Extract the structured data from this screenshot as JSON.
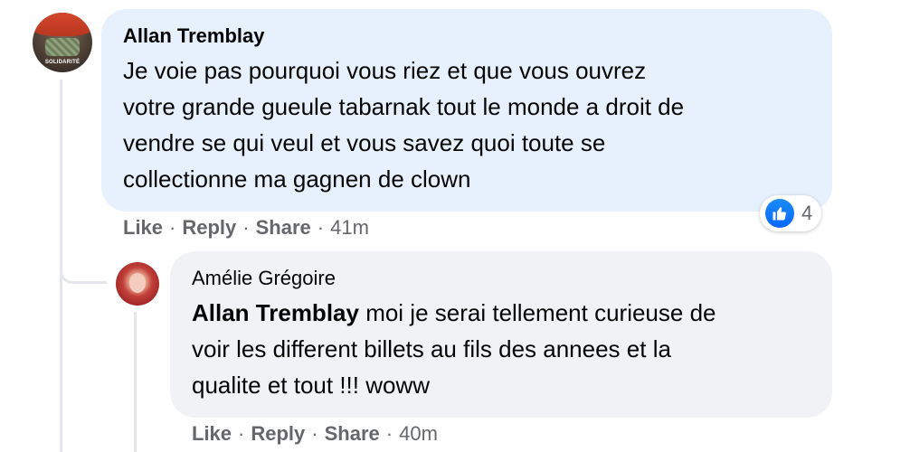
{
  "comment1": {
    "author": "Allan Tremblay",
    "avatar_label": "SOLIDARITÉ",
    "text": "Je voie pas pourquoi vous riez et que vous ouvrez votre grande gueule tabarnak tout le monde a droit de vendre se qui veul et vous savez quoi toute se collectionne ma gagnen de clown",
    "text_lines": [
      "Je voie pas pourquoi vous riez et que vous ouvrez",
      "votre grande gueule tabarnak tout le monde a droit de",
      "vendre se qui veul et vous savez quoi toute se",
      "collectionne ma gagnen de clown"
    ],
    "reactions": {
      "icon": "thumbs-up-icon",
      "count": "4"
    },
    "actions": {
      "like": "Like",
      "reply": "Reply",
      "share": "Share",
      "time": "41m",
      "separator": "·"
    }
  },
  "comment2": {
    "author": "Amélie Grégoire",
    "mention": "Allan Tremblay",
    "text_lines": [
      " moi je serai tellement curieuse de",
      "voir les different billets au fils des annees et la",
      "qualite et tout !!! woww"
    ],
    "actions": {
      "like": "Like",
      "reply": "Reply",
      "share": "Share",
      "time": "40m",
      "separator": "·"
    }
  },
  "colors": {
    "bubble_highlight": "#e7f0fd",
    "bubble": "#f0f2f5",
    "meta_text": "#65676b",
    "like_blue": "#0866ff"
  }
}
